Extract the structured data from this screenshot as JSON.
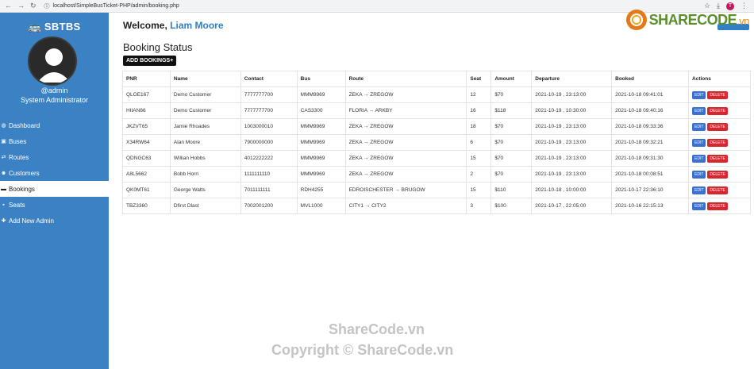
{
  "browser": {
    "url": "localhost/SimpleBusTicket-PHP/admin/booking.php",
    "profile_initial": "T"
  },
  "sidebar": {
    "brand": "SBTBS",
    "username": "@admin",
    "role": "System Administrator",
    "items": [
      {
        "label": "Dashboard",
        "icon": "dashboard-icon"
      },
      {
        "label": "Buses",
        "icon": "bus-icon"
      },
      {
        "label": "Routes",
        "icon": "routes-icon"
      },
      {
        "label": "Customers",
        "icon": "users-icon"
      },
      {
        "label": "Bookings",
        "icon": "ticket-icon"
      },
      {
        "label": "Seats",
        "icon": "seat-icon"
      },
      {
        "label": "Add New Admin",
        "icon": "add-user-icon"
      }
    ]
  },
  "header": {
    "welcome": "Welcome,",
    "user_name": "Liam Moore"
  },
  "logo": {
    "text": "SHARECODE",
    "suffix": ".vn"
  },
  "page": {
    "title": "Booking Status",
    "add_button": "ADD BOOKINGS+"
  },
  "table": {
    "columns": [
      "PNR",
      "Name",
      "Contact",
      "Bus",
      "Route",
      "Seat",
      "Amount",
      "Departure",
      "Booked",
      "Actions"
    ],
    "rows": [
      [
        "QLOE167",
        "Demo Customer",
        "7777777700",
        "MMM9969",
        "ZEKA → ZREGOW",
        "12",
        "$70",
        "2021-10-19 , 23:13:00",
        "2021-10-18 09:41:01"
      ],
      [
        "HIIAN66",
        "Demo Customer",
        "7777777700",
        "CAS3300",
        "FLORIA → ARKBY",
        "16",
        "$118",
        "2021-10-19 , 10:30:00",
        "2021-10-18 09:40:16"
      ],
      [
        "JKZVT65",
        "Jamie Rhoades",
        "1003000010",
        "MMM9969",
        "ZEKA → ZREGOW",
        "18",
        "$70",
        "2021-10-19 , 23:13:00",
        "2021-10-18 09:33:36"
      ],
      [
        "X34RW64",
        "Alan Moore",
        "7900000000",
        "MMM9969",
        "ZEKA → ZREGOW",
        "6",
        "$70",
        "2021-10-19 , 23:13:00",
        "2021-10-18 09:32:21"
      ],
      [
        "QDNGC63",
        "Willian Hobbs",
        "4012222222",
        "MMM9969",
        "ZEKA → ZREGOW",
        "15",
        "$70",
        "2021-10-19 , 23:13:00",
        "2021-10-18 09:31:30"
      ],
      [
        "A8L5662",
        "Bobb Horn",
        "1111111110",
        "MMM9969",
        "ZEKA → ZREGOW",
        "2",
        "$70",
        "2021-10-19 , 23:13:00",
        "2021-10-18 00:08:51"
      ],
      [
        "QK0MT61",
        "George Watts",
        "7011111111",
        "RDH4255",
        "EDROISCHESTER → BRUGOW",
        "15",
        "$110",
        "2021-10-18 , 10:00:00",
        "2021-10-17 22:36:10"
      ],
      [
        "TBZ3360",
        "Dfirst Dlast",
        "7002001200",
        "MVL1000",
        "CITY1 → CITY2",
        "3",
        "$100",
        "2021-10-17 , 22:05:00",
        "2021-10-16 22:15:13"
      ]
    ],
    "edit_label": "EDIT",
    "delete_label": "DELETE"
  },
  "watermark": {
    "line1": "ShareCode.vn",
    "line2": "Copyright © ShareCode.vn"
  }
}
